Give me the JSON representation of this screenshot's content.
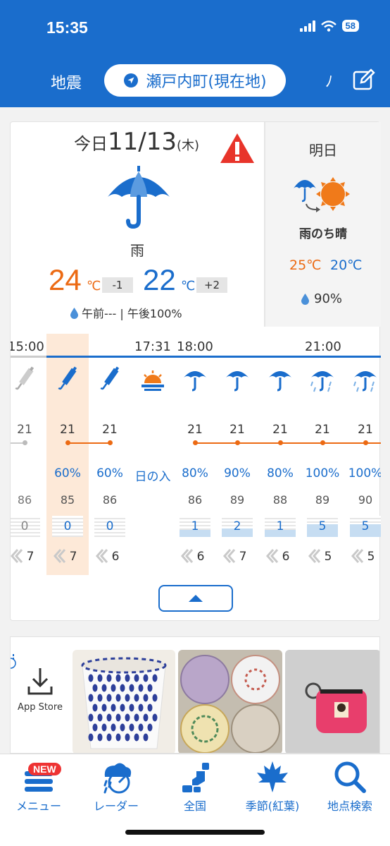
{
  "status_bar": {
    "time": "15:35",
    "battery": "58"
  },
  "header": {
    "quake_label": "地震",
    "location": "瀬戸内町(現在地)",
    "more_label": "ﾉ"
  },
  "today": {
    "label": "今日",
    "date": "11/13",
    "weekday": "(木)",
    "weather": "雨",
    "high": "24",
    "high_diff": "-1",
    "low": "22",
    "low_diff": "+2",
    "unit": "℃",
    "precip": "午前--- | 午後100%"
  },
  "tomorrow": {
    "label": "明日",
    "weather": "雨のち晴",
    "high": "25℃",
    "low": "20℃",
    "precip": "90%"
  },
  "hourly": {
    "time_labels": [
      "15:00",
      "17:31",
      "18:00",
      "21:00"
    ],
    "icons": [
      "umbrella-closed",
      "umbrella-closed",
      "umbrella-closed",
      "sunset",
      "umbrella-open",
      "umbrella-open",
      "umbrella-open",
      "umbrella-rain",
      "umbrella-rain"
    ],
    "temps": [
      "21",
      "21",
      "21",
      "",
      "21",
      "21",
      "21",
      "21",
      "21"
    ],
    "pops": [
      "",
      "60%",
      "60%",
      "日の入",
      "80%",
      "90%",
      "80%",
      "100%",
      "100%"
    ],
    "humidity": [
      "86",
      "85",
      "86",
      "",
      "86",
      "89",
      "88",
      "89",
      "90"
    ],
    "rain": [
      "0",
      "0",
      "0",
      "",
      "1",
      "2",
      "1",
      "5",
      "5"
    ],
    "wind": [
      "7",
      "7",
      "6",
      "",
      "6",
      "7",
      "6",
      "5",
      "5"
    ]
  },
  "ads": {
    "appstore_label": "App Store"
  },
  "bottom_nav": {
    "new_badge": "NEW",
    "items": [
      {
        "label": "メニュー"
      },
      {
        "label": "レーダー"
      },
      {
        "label": "全国"
      },
      {
        "label": "季節(紅葉)"
      },
      {
        "label": "地点検索"
      }
    ]
  },
  "colors": {
    "primary": "#1a6dcc",
    "high": "#ec6a13",
    "highlight": "#fde9d8"
  }
}
